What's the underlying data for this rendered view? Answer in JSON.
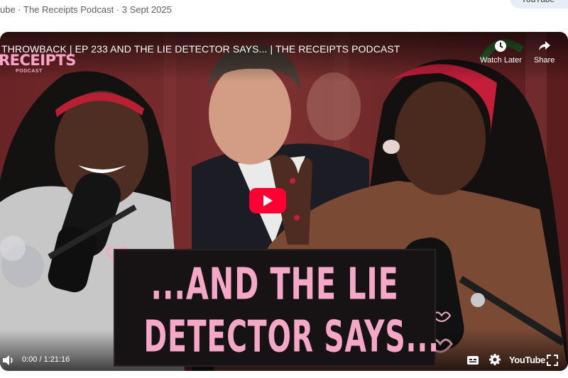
{
  "page": {
    "meta_line": "ube · The Receipts Podcast · 3 Sept 2025",
    "top_chip_label": "YouTube"
  },
  "player": {
    "video_title": "THROWBACK | EP 233 AND THE LIE DETECTOR SAYS... | THE RECEIPTS PODCAST",
    "channel_logo_text": "RECEIPTS",
    "channel_logo_sub": "PODCAST",
    "watch_later_label": "Watch Later",
    "share_label": "Share",
    "thumbnail_banner_line1": "...AND THE LIE",
    "thumbnail_banner_line2": "DETECTOR SAYS...",
    "time_display": "0:00 / 1:21:16",
    "youtube_logo_label": "YouTube",
    "icons": {
      "play": "play-icon",
      "watch_later": "clock-icon",
      "share": "share-arrow-icon",
      "volume": "volume-icon",
      "captions": "captions-icon",
      "settings": "gear-icon",
      "fullscreen": "fullscreen-icon"
    }
  },
  "colors": {
    "play_button": "#ff0033",
    "banner_text": "#f4a7c7",
    "banner_background": "#171314",
    "headband": "#c41e3a",
    "backdrop": "#5b1d1e"
  }
}
